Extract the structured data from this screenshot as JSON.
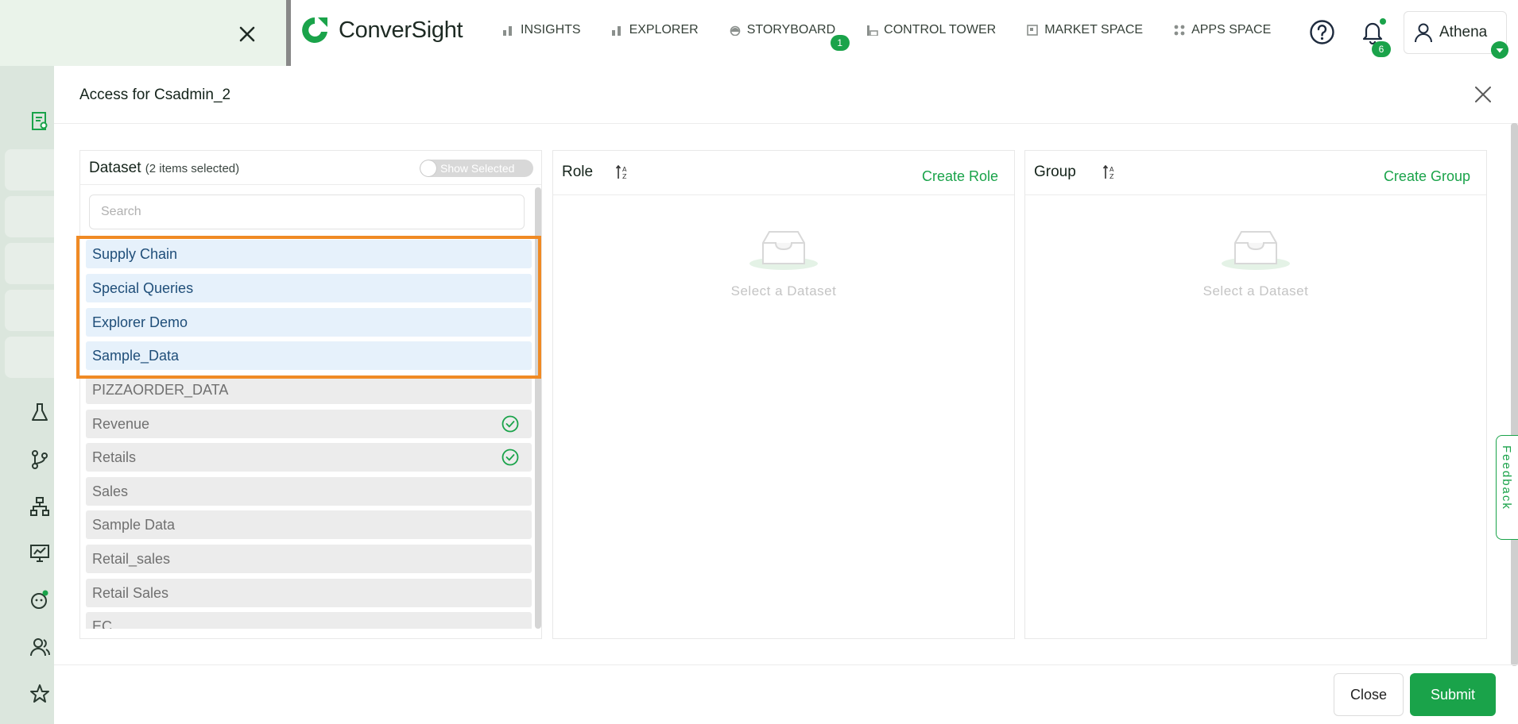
{
  "app": {
    "brand": "ConverSight"
  },
  "nav": [
    {
      "label": "INSIGHTS",
      "icon": "bar-chart-icon"
    },
    {
      "label": "EXPLORER",
      "icon": "bar-chart-icon"
    },
    {
      "label": "STORYBOARD",
      "icon": "storyboard-icon",
      "badge": "1"
    },
    {
      "label": "CONTROL TOWER",
      "icon": "control-tower-icon"
    },
    {
      "label": "MARKET SPACE",
      "icon": "market-space-icon"
    },
    {
      "label": "APPS SPACE",
      "icon": "apps-space-icon"
    }
  ],
  "header": {
    "notifications_count": "6",
    "user_name": "Athena"
  },
  "modal": {
    "title": "Access for Csadmin_2",
    "dataset_panel": {
      "title": "Dataset",
      "subtitle": "(2 items selected)",
      "toggle_label": "Show Selected",
      "search_placeholder": "Search",
      "items": [
        {
          "label": "Supply Chain",
          "state": "highlighted"
        },
        {
          "label": "Special Queries",
          "state": "highlighted"
        },
        {
          "label": "Explorer Demo",
          "state": "highlighted"
        },
        {
          "label": "Sample_Data",
          "state": "highlighted"
        },
        {
          "label": "PIZZAORDER_DATA",
          "state": "normal"
        },
        {
          "label": "Revenue",
          "state": "checked"
        },
        {
          "label": "Retails",
          "state": "checked"
        },
        {
          "label": "Sales",
          "state": "normal"
        },
        {
          "label": "Sample Data",
          "state": "normal"
        },
        {
          "label": "Retail_sales",
          "state": "normal"
        },
        {
          "label": "Retail Sales",
          "state": "normal"
        },
        {
          "label": "EC",
          "state": "normal"
        }
      ]
    },
    "role_panel": {
      "title": "Role",
      "create_label": "Create Role",
      "empty_text": "Select a Dataset"
    },
    "group_panel": {
      "title": "Group",
      "create_label": "Create Group",
      "empty_text": "Select a Dataset"
    },
    "footer": {
      "close_label": "Close",
      "submit_label": "Submit"
    }
  },
  "feedback_label": "Feedback",
  "colors": {
    "accent": "#1aa34a",
    "highlight_border": "#f08a24",
    "selected_bg": "#e6f1fb"
  }
}
